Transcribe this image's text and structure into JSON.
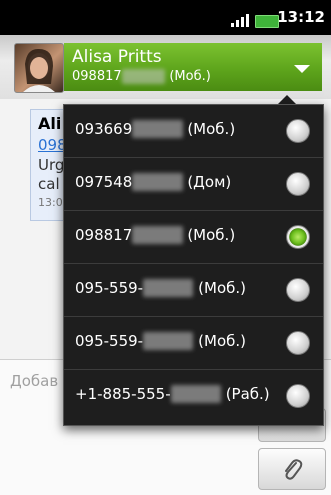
{
  "status_bar": {
    "time": "13:12"
  },
  "contact": {
    "name": "Alisa Pritts",
    "number_prefix": "098817",
    "number_hidden": "####",
    "number_type": "(Моб.)"
  },
  "conversation": {
    "sender_name": "Ali",
    "sender_number": "098",
    "message_lines": [
      "Urg",
      "cal"
    ],
    "time": "13:0"
  },
  "compose": {
    "placeholder": "Добав"
  },
  "number_picker": {
    "options": [
      {
        "prefix": "093669",
        "hidden": "####",
        "type": "(Моб.)",
        "selected": false
      },
      {
        "prefix": "097548",
        "hidden": "####",
        "type": "(Дом)",
        "selected": false
      },
      {
        "prefix": "098817",
        "hidden": "####",
        "type": "(Моб.)",
        "selected": true
      },
      {
        "prefix": "095-559-",
        "hidden": "####",
        "type": "(Моб.)",
        "selected": false
      },
      {
        "prefix": "095-559-",
        "hidden": "####",
        "type": "(Моб.)",
        "selected": false
      },
      {
        "prefix": "+1-885-555-",
        "hidden": "####",
        "type": "(Раб.)",
        "selected": false
      }
    ]
  },
  "colors": {
    "accent_green": "#5ea51c",
    "popup_bg": "#1e1e1e",
    "link_blue": "#2a72d4"
  }
}
